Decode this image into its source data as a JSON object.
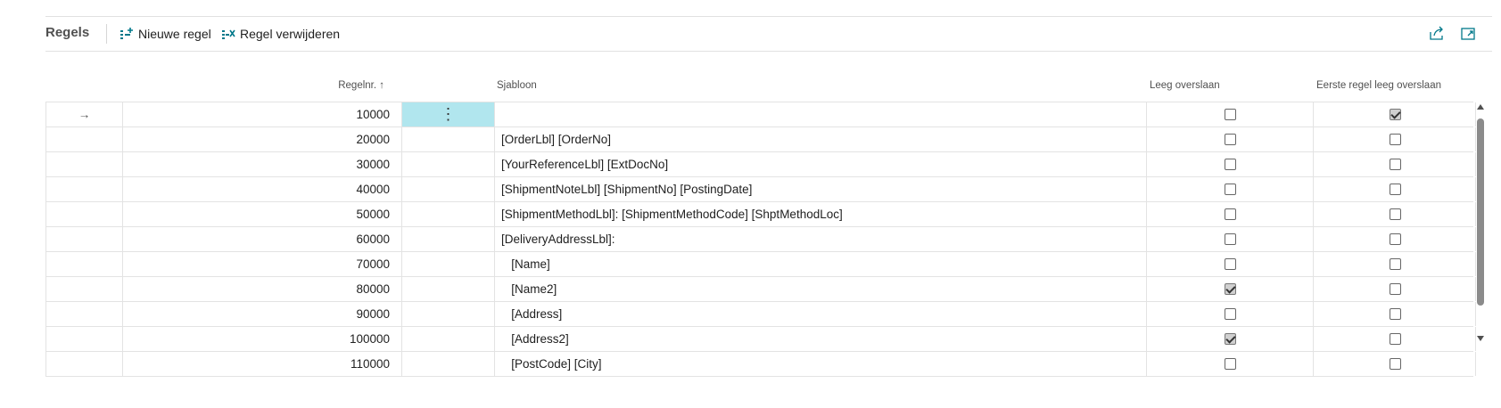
{
  "toolbar": {
    "title": "Regels",
    "new_line_label": "Nieuwe regel",
    "delete_line_label": "Regel verwijderen"
  },
  "columns": {
    "regelnr": "Regelnr. ↑",
    "sjabloon": "Sjabloon",
    "leeg_overslaan": "Leeg overslaan",
    "eerste_regel": "Eerste regel leeg overslaan"
  },
  "rows": [
    {
      "arrow": "→",
      "nr": "10000",
      "sjabloon": "",
      "leeg": false,
      "eerste": true,
      "active": true
    },
    {
      "arrow": "",
      "nr": "20000",
      "sjabloon": "[OrderLbl] [OrderNo]",
      "leeg": false,
      "eerste": false
    },
    {
      "arrow": "",
      "nr": "30000",
      "sjabloon": "[YourReferenceLbl] [ExtDocNo]",
      "leeg": false,
      "eerste": false
    },
    {
      "arrow": "",
      "nr": "40000",
      "sjabloon": "[ShipmentNoteLbl] [ShipmentNo] [PostingDate]",
      "leeg": false,
      "eerste": false
    },
    {
      "arrow": "",
      "nr": "50000",
      "sjabloon": "[ShipmentMethodLbl]: [ShipmentMethodCode] [ShptMethodLoc]",
      "leeg": false,
      "eerste": false
    },
    {
      "arrow": "",
      "nr": "60000",
      "sjabloon": "[DeliveryAddressLbl]:",
      "leeg": false,
      "eerste": false
    },
    {
      "arrow": "",
      "nr": "70000",
      "sjabloon": "   [Name]",
      "leeg": false,
      "eerste": false
    },
    {
      "arrow": "",
      "nr": "80000",
      "sjabloon": "   [Name2]",
      "leeg": true,
      "eerste": false
    },
    {
      "arrow": "",
      "nr": "90000",
      "sjabloon": "   [Address]",
      "leeg": false,
      "eerste": false
    },
    {
      "arrow": "",
      "nr": "100000",
      "sjabloon": "   [Address2]",
      "leeg": true,
      "eerste": false
    },
    {
      "arrow": "",
      "nr": "110000",
      "sjabloon": "   [PostCode] [City]",
      "leeg": false,
      "eerste": false
    }
  ],
  "row_menu_glyph": "⋮",
  "icons": {
    "new_line": "new-line-icon",
    "delete_line": "delete-line-icon",
    "share": "share-icon",
    "expand": "expand-icon"
  },
  "colors": {
    "accent": "#00788a",
    "active_cell": "#b1e6ee"
  }
}
